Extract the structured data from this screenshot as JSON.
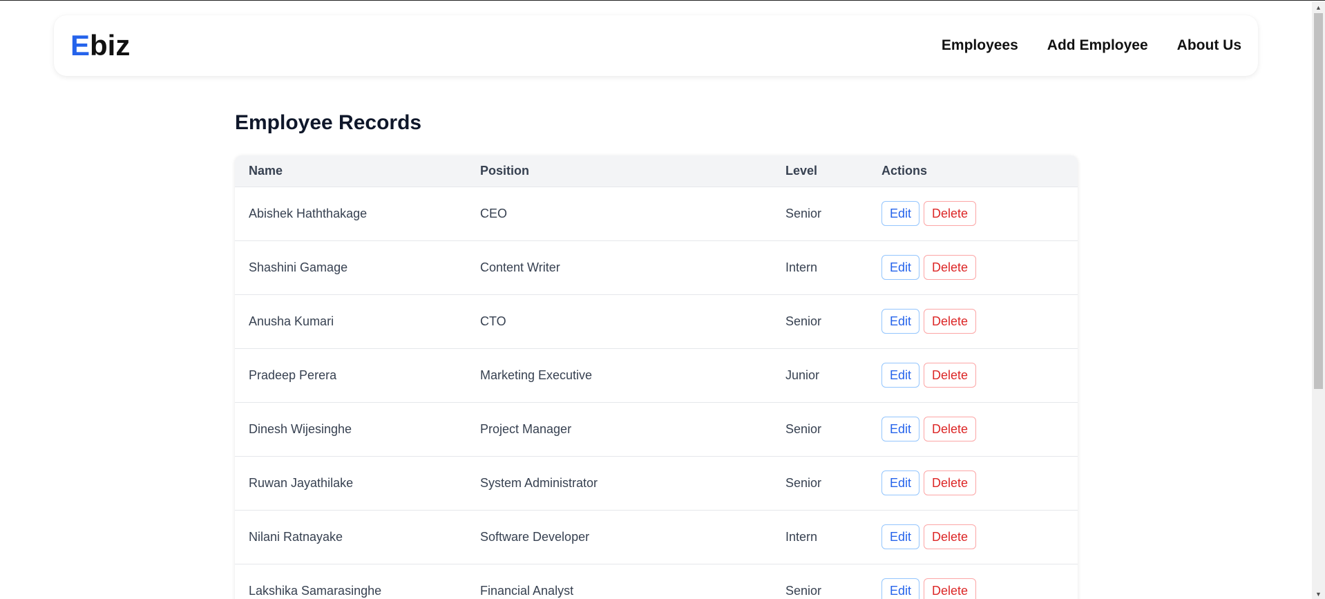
{
  "navbar": {
    "logo_accent": "E",
    "logo_rest": "biz",
    "links": [
      "Employees",
      "Add Employee",
      "About Us"
    ]
  },
  "page": {
    "title": "Employee Records"
  },
  "table": {
    "headers": [
      "Name",
      "Position",
      "Level",
      "Actions"
    ],
    "edit_label": "Edit",
    "delete_label": "Delete",
    "rows": [
      {
        "name": "Abishek Haththakage",
        "position": "CEO",
        "level": "Senior"
      },
      {
        "name": "Shashini Gamage",
        "position": "Content Writer",
        "level": "Intern"
      },
      {
        "name": "Anusha Kumari",
        "position": "CTO",
        "level": "Senior"
      },
      {
        "name": "Pradeep Perera",
        "position": "Marketing Executive",
        "level": "Junior"
      },
      {
        "name": "Dinesh Wijesinghe",
        "position": "Project Manager",
        "level": "Senior"
      },
      {
        "name": "Ruwan Jayathilake",
        "position": "System Administrator",
        "level": "Senior"
      },
      {
        "name": "Nilani Ratnayake",
        "position": "Software Developer",
        "level": "Intern"
      },
      {
        "name": "Lakshika Samarasinghe",
        "position": "Financial Analyst",
        "level": "Senior"
      }
    ]
  },
  "colors": {
    "accent": "#2563eb",
    "danger": "#dc2626"
  }
}
